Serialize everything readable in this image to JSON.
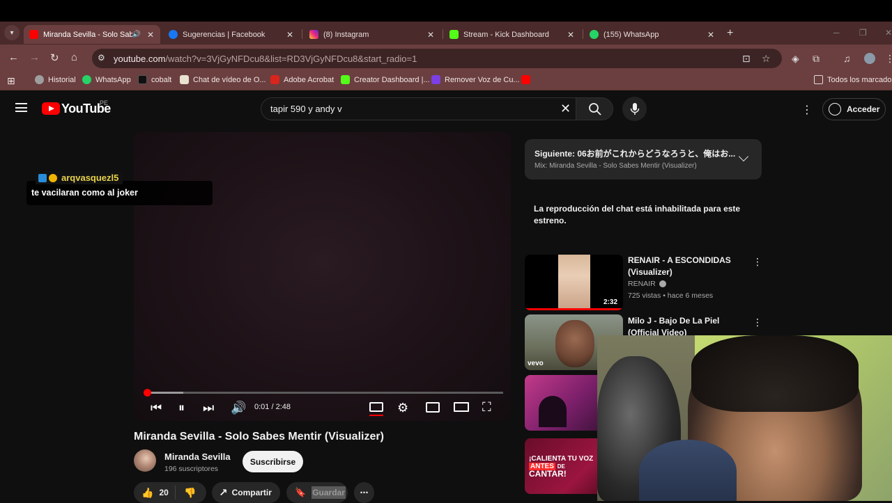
{
  "browser": {
    "tabs": [
      {
        "label": "Miranda Sevilla - Solo Sabe",
        "active": true,
        "color": "#ff0000"
      },
      {
        "label": "Sugerencias | Facebook",
        "color": "#1877f2"
      },
      {
        "label": "(8) Instagram",
        "color": "#e1306c"
      },
      {
        "label": "Stream - Kick Dashboard",
        "color": "#53fc18"
      },
      {
        "label": "(155) WhatsApp",
        "color": "#25d366"
      }
    ],
    "url_host": "youtube.com",
    "url_rest": "/watch?v=3VjGyNFDcu8&list=RD3VjGyNFDcu8&start_radio=1",
    "bookmarks": [
      {
        "label": "Historial",
        "color": "#9e9e9e"
      },
      {
        "label": "WhatsApp",
        "color": "#25d366"
      },
      {
        "label": "cobalt",
        "color": "#111111"
      },
      {
        "label": "Chat de vídeo de O...",
        "color": "#e9e2d0"
      },
      {
        "label": "Adobe Acrobat",
        "color": "#d9251c"
      },
      {
        "label": "Creator Dashboard |...",
        "color": "#53fc18"
      },
      {
        "label": "Remover Voz de Cu...",
        "color": "#7b3fe4"
      }
    ],
    "bookmarks_folder": "Todos los marcadores"
  },
  "youtube": {
    "logo_text": "YouTube",
    "region": "PE",
    "search_value": "tapir 590 y andy v",
    "signin_label": "Acceder",
    "player": {
      "time": "0:01 / 2:48",
      "progress_played": 0.01,
      "progress_buffered": 0.11
    },
    "chat_overlay": {
      "user": "arqvasquezl5",
      "message": "te vacilaran como al joker"
    },
    "video_title": "Miranda Sevilla - Solo Sabes Mentir (Visualizer)",
    "channel": {
      "name": "Miranda Sevilla",
      "subscribers": "196 suscriptores",
      "subscribe_label": "Suscribirse"
    },
    "actions": {
      "likes": "20",
      "share_label": "Compartir",
      "save_label": "Guardar"
    },
    "up_next": {
      "title": "Siguiente: 06お前がこれからどうなろうと、俺はお...",
      "subtitle": "Mix: Miranda Sevilla - Solo Sabes Mentir (Visualizer)"
    },
    "chat_disabled": "La reproducción del chat está inhabilitada para este estreno.",
    "recommendations": [
      {
        "title": "RENAIR - A ESCONDIDAS (Visualizer)",
        "channel": "RENAIR",
        "meta": "725 vistas • hace 6 meses",
        "duration": "2:32"
      },
      {
        "title": "Milo J - Bajo De La Piel (Official Video)",
        "badge": "vevo"
      },
      {
        "title": ""
      },
      {
        "title": "",
        "thumb_text_1": "¡CALIENTA TU VOZ",
        "thumb_text_2": "ANTES",
        "thumb_text_3": "DE",
        "thumb_text_4": "CANTAR!"
      }
    ]
  }
}
